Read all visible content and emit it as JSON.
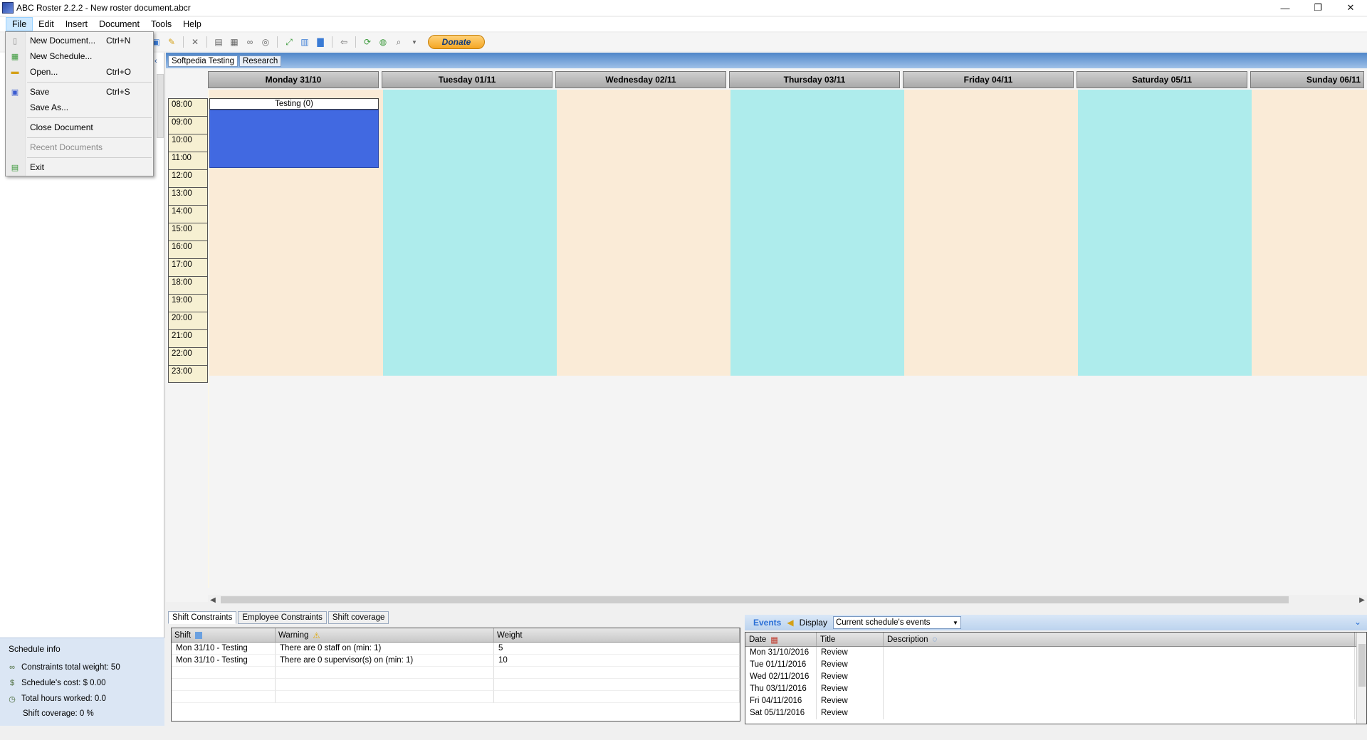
{
  "window": {
    "title": "ABC Roster 2.2.2 - New roster document.abcr",
    "minimize": "—",
    "restore": "❐",
    "close": "✕"
  },
  "menubar": {
    "file": "File",
    "edit": "Edit",
    "insert": "Insert",
    "document": "Document",
    "tools": "Tools",
    "help": "Help"
  },
  "file_menu": {
    "new_document": "New Document...",
    "new_document_shortcut": "Ctrl+N",
    "new_schedule": "New Schedule...",
    "open": "Open...",
    "open_shortcut": "Ctrl+O",
    "save": "Save",
    "save_shortcut": "Ctrl+S",
    "save_as": "Save As...",
    "close_document": "Close Document",
    "recent_documents": "Recent Documents",
    "exit": "Exit"
  },
  "toolbar": {
    "donate": "Donate"
  },
  "schedule_tabs": [
    "Softpedia Testing",
    "Research"
  ],
  "days": [
    "Monday 31/10",
    "Tuesday 01/11",
    "Wednesday 02/11",
    "Thursday 03/11",
    "Friday 04/11",
    "Saturday 05/11",
    "Sunday 06/11"
  ],
  "times": [
    "08:00",
    "09:00",
    "10:00",
    "11:00",
    "12:00",
    "13:00",
    "14:00",
    "15:00",
    "16:00",
    "17:00",
    "18:00",
    "19:00",
    "20:00",
    "21:00",
    "22:00",
    "23:00"
  ],
  "shift": {
    "label": "Testing (0)",
    "color": "#4169e1"
  },
  "colors": {
    "peach": "#faebd7",
    "cyan": "#aeecec"
  },
  "schedule_info": {
    "title": "Schedule info",
    "constraints_weight": "Constraints total weight: 50",
    "cost": "Schedule's cost: $ 0.00",
    "hours": "Total hours worked: 0.0",
    "coverage": "Shift coverage: 0 %"
  },
  "bottom_tabs": [
    "Shift Constraints",
    "Employee Constraints",
    "Shift coverage"
  ],
  "constraints": {
    "headers": [
      "Shift",
      "Warning",
      "Weight"
    ],
    "rows": [
      [
        "Mon 31/10 - Testing",
        "There are 0 staff on (min: 1)",
        "5"
      ],
      [
        "Mon 31/10 - Testing",
        "There are 0 supervisor(s) on (min: 1)",
        "10"
      ]
    ]
  },
  "events": {
    "title": "Events",
    "display_label": "Display",
    "display_value": "Current schedule's events",
    "headers": [
      "Date",
      "Title",
      "Description"
    ],
    "rows": [
      [
        "Mon 31/10/2016",
        "Review"
      ],
      [
        "Tue 01/11/2016",
        "Review"
      ],
      [
        "Wed 02/11/2016",
        "Review"
      ],
      [
        "Thu 03/11/2016",
        "Review"
      ],
      [
        "Fri 04/11/2016",
        "Review"
      ],
      [
        "Sat 05/11/2016",
        "Review"
      ]
    ]
  }
}
